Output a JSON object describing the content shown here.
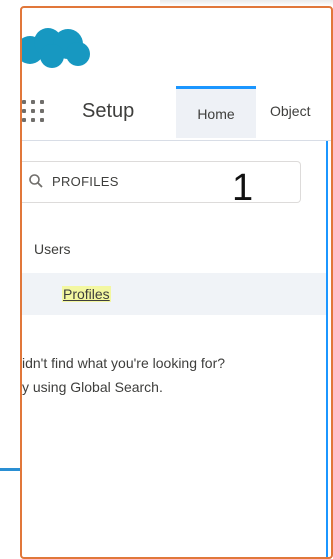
{
  "header": {
    "logo_icon": "salesforce-cloud-icon",
    "app_launcher_icon": "app-launcher-grid-icon",
    "title": "Setup"
  },
  "tabs": [
    {
      "label": "Home",
      "active": true
    },
    {
      "label": "Object"
    }
  ],
  "search": {
    "icon": "search-icon",
    "value": "PROFILES"
  },
  "annotation": {
    "number": "1"
  },
  "tree": {
    "parent_label": "Users",
    "child_label": "Profiles"
  },
  "help": {
    "line1": "idn't find what you're looking for?",
    "line2": "y using Global Search."
  },
  "colors": {
    "brand_blue": "#1b96ff",
    "annotation_border": "#e1773a",
    "highlight": "#f3f7a1"
  }
}
